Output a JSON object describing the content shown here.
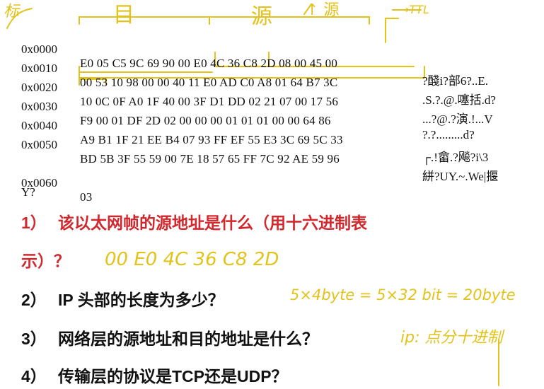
{
  "hexdump": {
    "rows": [
      {
        "offset": "0x0000",
        "hex": "E0 05 C5 9C 69 90 00 E0 4C 36 C8 2D 08 00 45 00",
        "ascii": "?醆i?部6?..E."
      },
      {
        "offset": "0x0010",
        "hex": "00 53 10 98 00 00 40 11 E0 AD C0 A8 01 64 B7 3C",
        "ascii": ".S.?.@.噻括.d?"
      },
      {
        "offset": "0x0020",
        "hex": "10 0C 0F A0 1F 40 00 3F D1 DD 02 21 07 00 17 56",
        "ascii": "...?@.?演.!...V"
      },
      {
        "offset": "0x0030",
        "hex": "F9 00 01 DF 2D 02 00 00 00 01 01 01 00 00 64 86",
        "ascii": "?.?.........d?"
      },
      {
        "offset": "0x0040",
        "hex": "A9 B1 1F 21 EE B4 07 93 FF EF 55 E3 3C 69 5C 33",
        "ascii": "┌.!畲.?飚?i\\3"
      },
      {
        "offset": "0x0050",
        "hex": "BD 5B 3F 55 59 00 7E 18 57 65 FF 7C 92 AE 59 96",
        "ascii": "絣?UY.~.We|揠"
      },
      {
        "offset": "",
        "hex": "",
        "ascii": "Y?"
      },
      {
        "offset": "0x0060",
        "hex": "03",
        "ascii": ""
      }
    ]
  },
  "questions": [
    {
      "num": "1）",
      "text": "该以太网帧的源地址是什么（用十六进制表"
    },
    {
      "num": "",
      "text": "示）？"
    },
    {
      "num": "2）",
      "text": "IP 头部的长度为多少？"
    },
    {
      "num": "3）",
      "text": "网络层的源地址和目的地址是什么？"
    },
    {
      "num": "4）",
      "text": "传输层的协议是TCP还是UDP？"
    }
  ],
  "annotations": {
    "label_dest": "目",
    "label_src": "源",
    "label_top_left": "标",
    "label_top_mid": "↑ 源",
    "label_ttl": "→TTL",
    "answer1": "00 E0 4C 36 C8 2D",
    "answer2": "5×4byte = 5×32 bit = 20byte",
    "answer3": "ip: 点分十进制",
    "handwriting_color": "#e3c21a"
  },
  "colors": {
    "question_red": "#d2282d",
    "text": "#111111"
  }
}
